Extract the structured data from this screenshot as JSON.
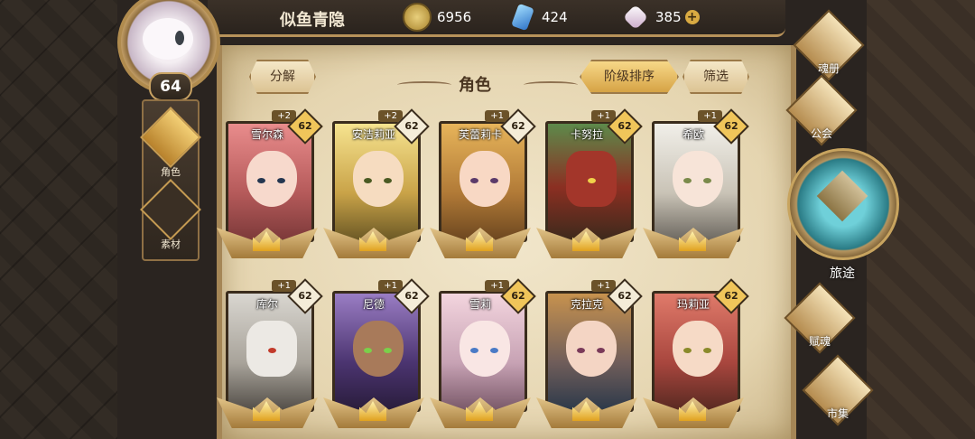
{
  "player": {
    "name": "似鱼青隐",
    "level": "64"
  },
  "resources": [
    {
      "icon": "gold-coin-icon",
      "value": "6956"
    },
    {
      "icon": "blue-crystal-icon",
      "value": "424"
    },
    {
      "icon": "white-crystal-icon",
      "value": "385"
    }
  ],
  "tabs": [
    {
      "label": "角色",
      "icon": "character-icon",
      "active": true
    },
    {
      "label": "素材",
      "icon": "material-icon",
      "active": false
    }
  ],
  "header": {
    "decompose": "分解",
    "title": "角色",
    "sort": "阶级排序",
    "filter": "筛选"
  },
  "heroes": [
    {
      "name": "雪尔森",
      "level": "62",
      "bonus": "+2"
    },
    {
      "name": "安洁莉亚",
      "level": "62",
      "bonus": "+2"
    },
    {
      "name": "芙蕾莉卡",
      "level": "62",
      "bonus": "+1"
    },
    {
      "name": "卡努拉",
      "level": "62",
      "bonus": "+1"
    },
    {
      "name": "希欧",
      "level": "62",
      "bonus": "+1"
    },
    {
      "name": "库尔",
      "level": "62",
      "bonus": "+1"
    },
    {
      "name": "尼德",
      "level": "62",
      "bonus": "+1"
    },
    {
      "name": "雪莉",
      "level": "62",
      "bonus": "+1"
    },
    {
      "name": "克拉克",
      "level": "62",
      "bonus": "+1"
    },
    {
      "name": "玛莉亚",
      "level": "62",
      "bonus": ""
    }
  ],
  "right_menu": {
    "soulbook": "魂册",
    "guild": "公会",
    "journey": "旅途",
    "talent": "赋魂",
    "market": "市集"
  },
  "colors": {
    "gold": "#d6a345",
    "parchment": "#eadcbc",
    "teal": "#2a7b85"
  }
}
